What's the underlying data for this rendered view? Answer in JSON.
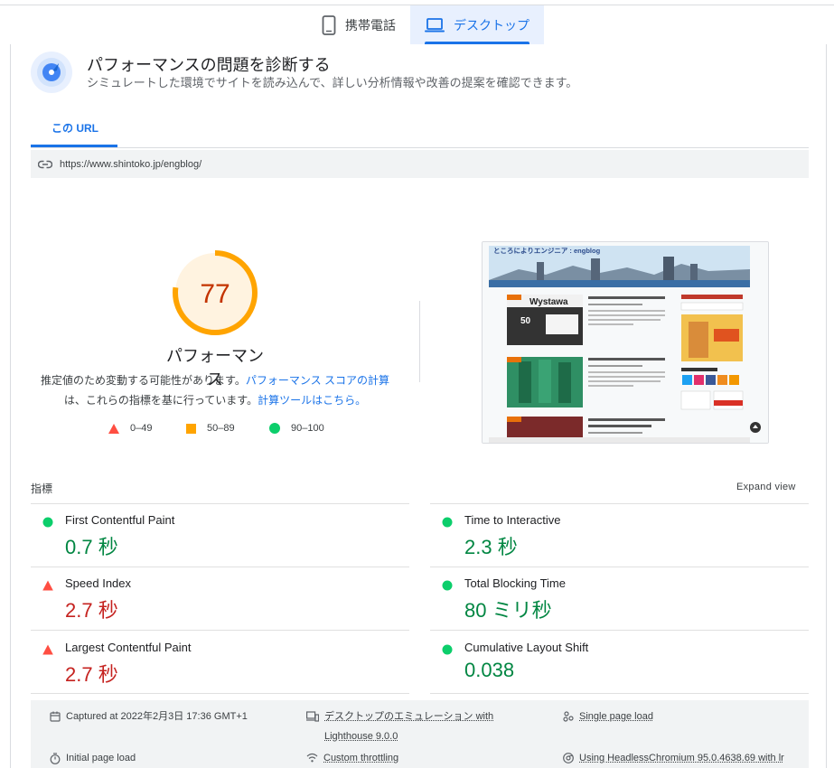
{
  "device_tabs": [
    {
      "label": "携帯電話",
      "active": false
    },
    {
      "label": "デスクトップ",
      "active": true
    }
  ],
  "diagnose": {
    "title": "パフォーマンスの問題を診断する",
    "subtitle": "シミュレートした環境でサイトを読み込んで、詳しい分析情報や改善の提案を確認できます。"
  },
  "url_tab": {
    "label": "この URL"
  },
  "url": "https://www.shintoko.jp/engblog/",
  "score": {
    "value": "77",
    "percent": 0.77,
    "label": "パフォーマンス",
    "desc_part1": "推定値のため変動する可能性があります。",
    "desc_link1": "パフォーマンス スコアの計算",
    "desc_part2": "は、これらの指標を基に行っています。",
    "desc_link2": "計算ツールはこちら。",
    "color_ring": "#ffa400",
    "color_text": "#c33300"
  },
  "legend": [
    {
      "range": "0–49",
      "color": "#ff4e42"
    },
    {
      "range": "50–89",
      "color": "#ffa400"
    },
    {
      "range": "90–100",
      "color": "#0cce6b"
    }
  ],
  "screenshot": {
    "site_title": "ところによりエンジニア : engblog",
    "card1_label": "Wystawa",
    "card1_number": "50"
  },
  "metrics": {
    "title": "指標",
    "expand": "Expand view",
    "items": [
      {
        "name": "First Contentful Paint",
        "value": "0.7 秒",
        "status": "good"
      },
      {
        "name": "Time to Interactive",
        "value": "2.3 秒",
        "status": "good"
      },
      {
        "name": "Speed Index",
        "value": "2.7 秒",
        "status": "bad"
      },
      {
        "name": "Total Blocking Time",
        "value": "80 ミリ秒",
        "status": "good"
      },
      {
        "name": "Largest Contentful Paint",
        "value": "2.7 秒",
        "status": "bad"
      },
      {
        "name": "Cumulative Layout Shift",
        "value": "0.038",
        "status": "good"
      }
    ],
    "colors": {
      "good": "#0cce6b",
      "bad": "#ff4e42",
      "good_text": "#018642",
      "bad_text": "#c5221f"
    }
  },
  "footer": {
    "captured": "Captured at 2022年2月3日 17:36 GMT+1",
    "emulation_line1": "デスクトップのエミュレーション with",
    "emulation_line2": "Lighthouse 9.0.0",
    "single_page": "Single page load",
    "initial_load": "Initial page load",
    "throttling": "Custom throttling",
    "browser": "Using HeadlessChromium 95.0.4638.69 with lr"
  }
}
